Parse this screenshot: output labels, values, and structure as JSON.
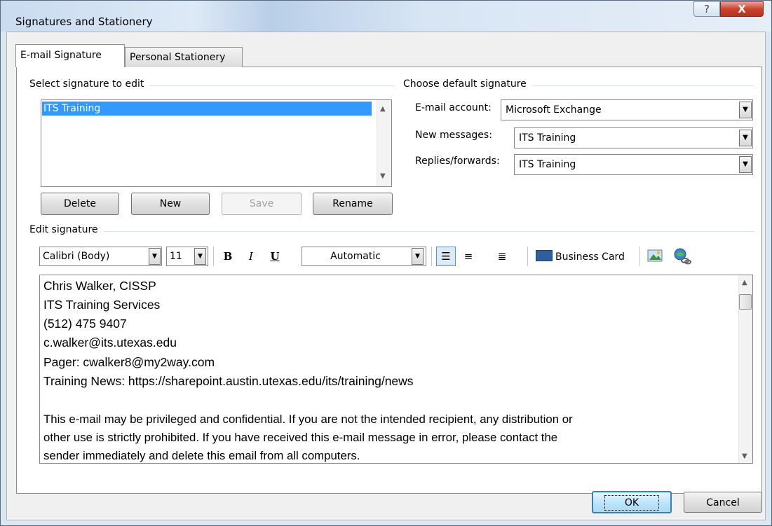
{
  "window": {
    "title": "Signatures and Stationery",
    "help_label": "?",
    "close_label": "X"
  },
  "tabs": [
    {
      "label": "E-mail Signature",
      "active": true
    },
    {
      "label": "Personal Stationery",
      "active": false
    }
  ],
  "select_group": {
    "label": "Select signature to edit",
    "signatures": [
      "ITS Training"
    ],
    "selected": "ITS Training"
  },
  "sig_buttons": {
    "delete": "Delete",
    "new": "New",
    "save": "Save",
    "rename": "Rename"
  },
  "default_group": {
    "label": "Choose default signature",
    "email_account_label": "E-mail account:",
    "email_account_value": "Microsoft Exchange",
    "new_messages_label": "New messages:",
    "new_messages_value": "ITS Training",
    "replies_label": "Replies/forwards:",
    "replies_value": "ITS Training"
  },
  "edit_group": {
    "label": "Edit signature"
  },
  "toolbar": {
    "font": "Calibri (Body)",
    "size": "11",
    "bold": "B",
    "italic": "I",
    "underline": "U",
    "color": "Automatic",
    "business_card": "Business Card"
  },
  "signature_lines": [
    "Chris Walker, CISSP",
    "ITS Training Services",
    "(512) 475 9407",
    "c.walker@its.utexas.edu",
    "Pager:  cwalker8@my2way.com",
    "Training News:  https://sharepoint.austin.utexas.edu/its/training/news",
    "This e-mail may be privileged and confidential.  If you are not the intended recipient, any distribution or",
    "other use is strictly prohibited.   If you have received this e-mail message in error, please contact the",
    "sender immediately and delete this email from all computers."
  ],
  "footer": {
    "ok": "OK",
    "cancel": "Cancel"
  }
}
